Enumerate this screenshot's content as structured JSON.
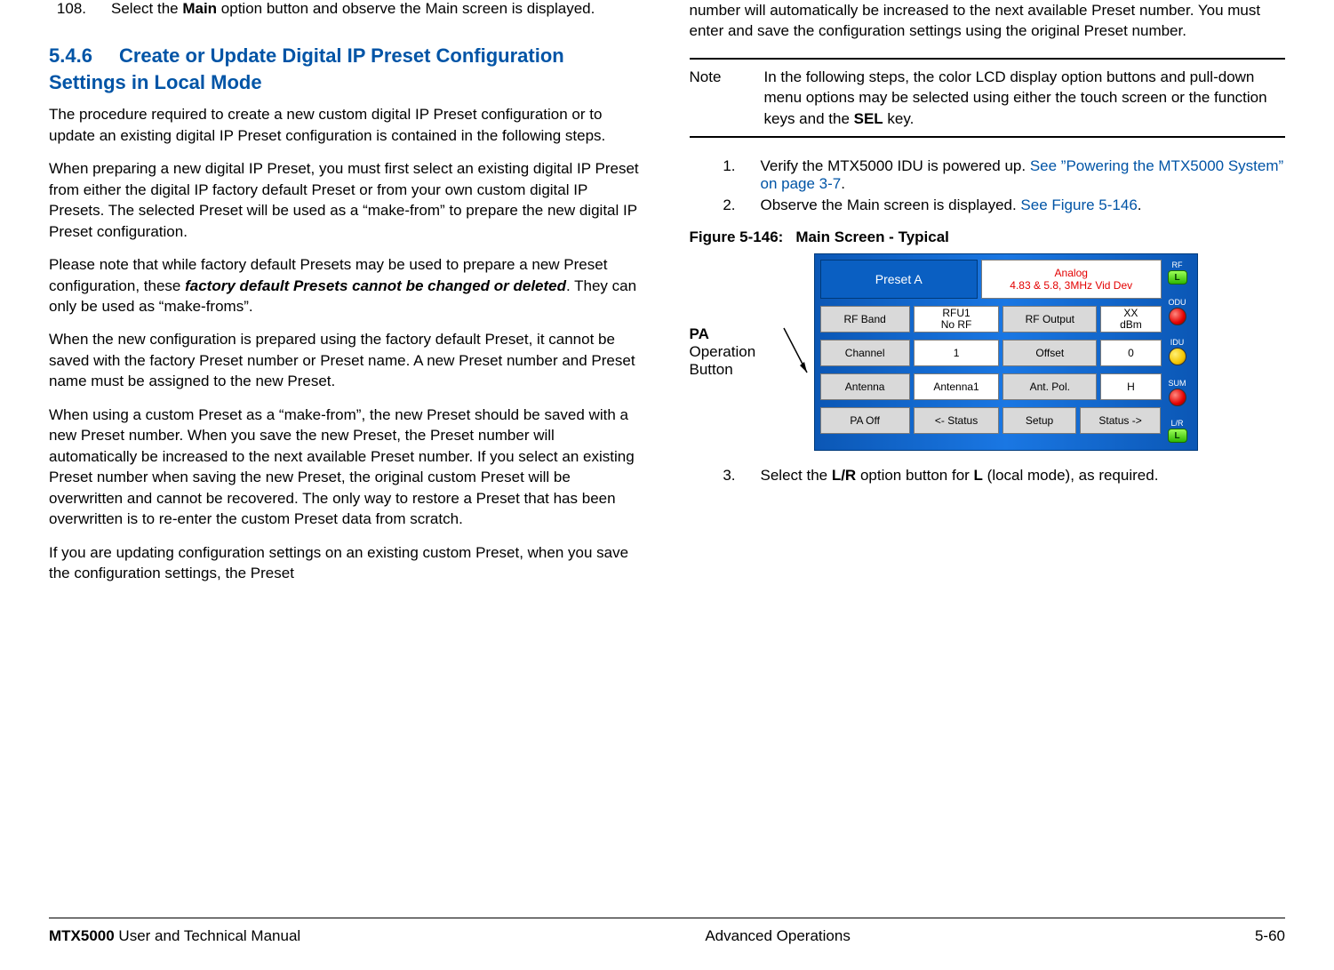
{
  "left": {
    "step108_num": "108.",
    "step108_text_a": "Select the ",
    "step108_main": "Main",
    "step108_text_b": " option button and observe the Main screen is displayed.",
    "heading_num": "5.4.6",
    "heading_text": "Create or Update Digital IP Preset Configuration Settings in Local Mode",
    "p1": "The procedure required to create a new custom digital IP Preset configuration or to update an existing digital IP Preset configuration is contained in the following steps.",
    "p2": "When preparing a new digital IP Preset, you must first select an existing digital IP Preset from either the digital IP factory default Preset or from your own custom digital IP Presets.  The selected Preset will be used as a “make-from” to prepare the new digital IP Preset configuration.",
    "p3a": "Please note that while factory default Presets may be used to prepare a new Preset configuration, these ",
    "p3b": "factory default Presets cannot be changed or deleted",
    "p3c": ".  They can only be used as “make-froms”.",
    "p4": "When the new configuration is prepared using the factory default Preset, it cannot be saved with the factory Preset number or Preset name.  A new Preset number and Preset name must be assigned to the new Preset.",
    "p5": "When using a custom Preset as a “make-from”, the new Preset should be saved with a new Preset number.  When you save the new Preset, the Preset number will automatically be increased to the next available Preset number.   If you select an existing Preset number when saving the new Preset, the original custom Preset will be overwritten and cannot be recovered.   The only way to restore a Preset that has been overwritten is to re-enter the custom Preset data from scratch.",
    "p6": "If you are updating configuration settings on an existing custom Preset, when you save the configuration settings, the Preset "
  },
  "right": {
    "cont": "number will automatically be increased to the next available Preset number.  You must enter and save the configuration settings using the original Preset number.",
    "note_label": "Note",
    "note_text_a": "In the following steps, the color LCD display option buttons and pull-down menu options may be selected using either the touch screen or the function keys and the ",
    "note_sel": "SEL",
    "note_text_b": " key.",
    "step1_num": "1.",
    "step1_a": "Verify the MTX5000 IDU is powered up.  ",
    "step1_link": "See ”Powering the MTX5000 System” on page 3-7",
    "step1_b": ".",
    "step2_num": "2.",
    "step2_a": "Observe the Main screen is displayed.  ",
    "step2_link": "See Figure 5-146",
    "step2_b": ".",
    "fig_label": "Figure 5-146:",
    "fig_title": "Main Screen - Typical",
    "pa_label_bold": "PA",
    "pa_label_rest": "Operation Button",
    "step3_num": "3.",
    "step3_a": "Select the ",
    "step3_lr": "L/R",
    "step3_b": " option button for ",
    "step3_l": "L",
    "step3_c": " (local mode), as required."
  },
  "lcd": {
    "preset": "Preset A",
    "analog1": "Analog",
    "analog2": "4.83 & 5.8, 3MHz Vid Dev",
    "rfband": "RF Band",
    "rfu": "RFU1\nNo RF",
    "rfout": "RF Output",
    "xx": "XX\ndBm",
    "channel": "Channel",
    "ch_val": "1",
    "offset": "Offset",
    "off_val": "0",
    "antenna": "Antenna",
    "ant_val": "Antenna1",
    "antpol": "Ant. Pol.",
    "pol_val": "H",
    "paoff": "PA Off",
    "status_l": "<- Status",
    "setup": "Setup",
    "status_r": "Status ->",
    "side_rf": "RF",
    "side_odu": "ODU",
    "side_idu": "IDU",
    "side_sum": "SUM",
    "side_lr": "L/R",
    "side_l": "L"
  },
  "footer": {
    "left_bold": "MTX5000",
    "left_rest": " User and Technical Manual",
    "center": "Advanced Operations",
    "right": "5-60"
  }
}
